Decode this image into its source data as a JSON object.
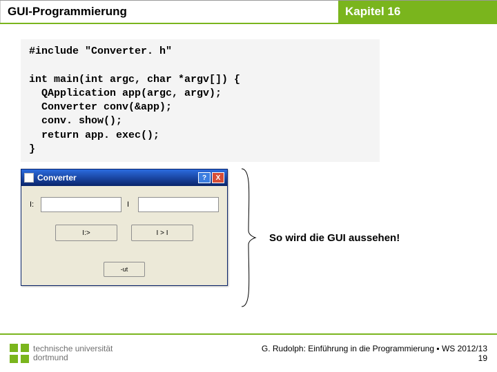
{
  "header": {
    "left": "GUI-Programmierung",
    "right": "Kapitel 16"
  },
  "code": "#include \"Converter. h\"\n\nint main(int argc, char *argv[]) {\n  QApplication app(argc, argv);\n  Converter conv(&app);\n  conv. show();\n  return app. exec();\n}",
  "window": {
    "title": "Converter",
    "help": "?",
    "close": "X",
    "label_left": "I:",
    "label_right": "I",
    "btn1": "I:>",
    "btn2": "I > I",
    "quit": "-ut"
  },
  "caption": "So wird die GUI aussehen!",
  "footer": {
    "uni1": "technische universität",
    "uni2": "dortmund",
    "credit": "G. Rudolph: Einführung in die Programmierung ▪ WS 2012/13",
    "page": "19"
  }
}
